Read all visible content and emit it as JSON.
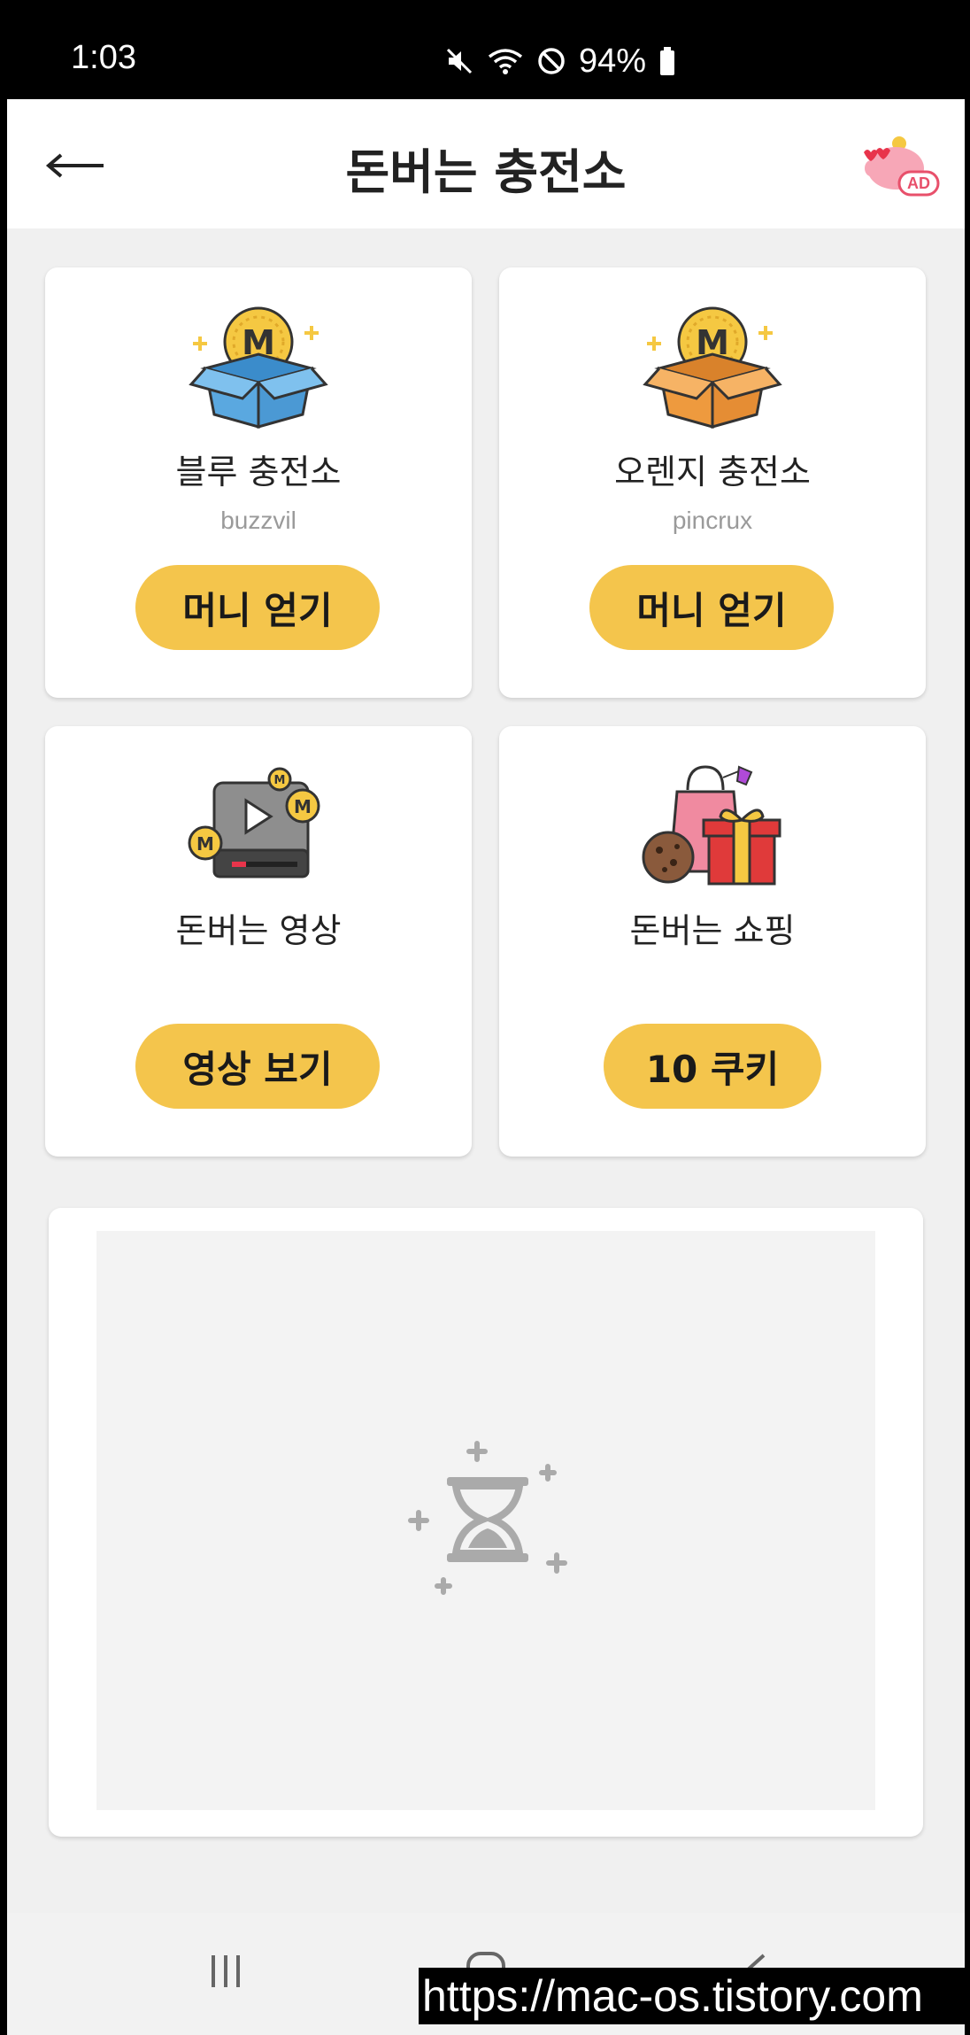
{
  "status_bar": {
    "time": "1:03",
    "battery": "94%",
    "icons": [
      "mute-icon",
      "wifi-icon",
      "do-not-disturb-icon",
      "battery-icon"
    ]
  },
  "header": {
    "title": "돈버는 충전소",
    "back_icon": "arrow-left-icon",
    "ad_icon": "piggy-bank-ad-icon",
    "ad_badge": "AD"
  },
  "cards": [
    {
      "title": "블루 충전소",
      "subtitle": "buzzvil",
      "button": "머니 얻기",
      "icon": "blue-coin-box-icon"
    },
    {
      "title": "오렌지 충전소",
      "subtitle": "pincrux",
      "button": "머니 얻기",
      "icon": "orange-coin-box-icon"
    },
    {
      "title": "돈버는 영상",
      "subtitle": "",
      "button": "영상 보기",
      "icon": "video-coins-icon"
    },
    {
      "title": "돈버는 쇼핑",
      "subtitle": "",
      "button": "10 쿠키",
      "icon": "shopping-gift-icon"
    }
  ],
  "ad_area": {
    "loader_icon": "hourglass-icon"
  },
  "nav": {
    "icons": [
      "recent-apps-icon",
      "home-icon",
      "back-icon"
    ]
  },
  "watermark": "https://mac-os.tistory.com",
  "colors": {
    "accent": "#f4c54c",
    "background": "#f0f0f0",
    "coin": "#f5c842",
    "blue_box": "#5aa8e0",
    "orange_box": "#ee9a3e"
  }
}
